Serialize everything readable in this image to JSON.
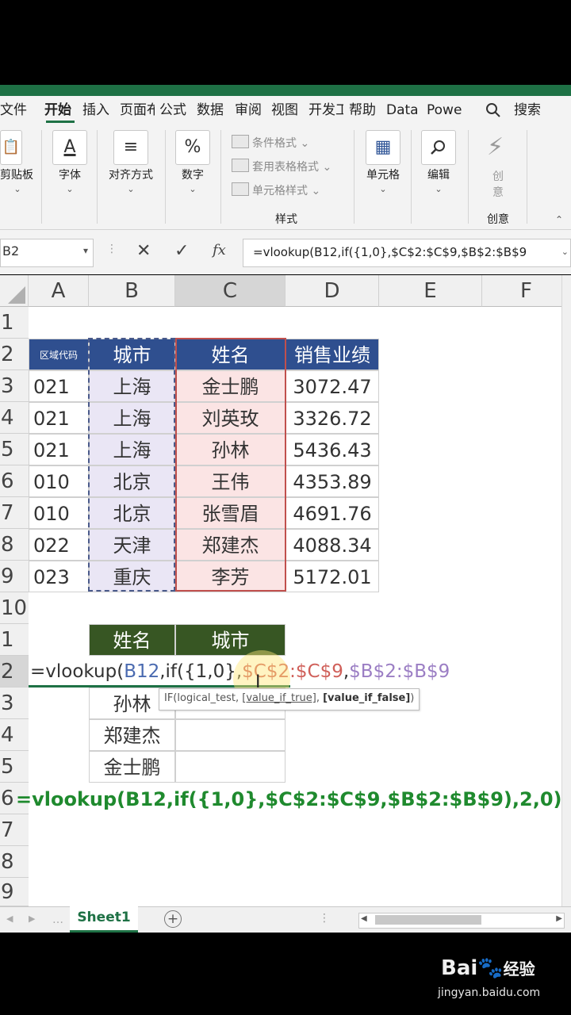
{
  "ribbon_tabs": [
    "文件",
    "开始",
    "插入",
    "页面布",
    "公式",
    "数据",
    "审阅",
    "视图",
    "开发工",
    "帮助",
    "Data",
    "Powe"
  ],
  "search_label": "搜索",
  "ribbon": {
    "clipboard": "剪贴板",
    "font": "字体",
    "font_icon": "A",
    "align": "对齐方式",
    "number": "数字",
    "number_icon": "%",
    "styles_items": [
      "条件格式 ⌄",
      "套用表格格式 ⌄",
      "单元格样式 ⌄"
    ],
    "styles_group": "样式",
    "cells": "单元格",
    "edit": "编辑",
    "creative_line1": "创",
    "creative_line2": "意",
    "creative_group": "创意"
  },
  "formula_bar": {
    "name_box": "B2",
    "cancel": "✕",
    "enter": "✓",
    "fx": "fx",
    "formula": "=vlookup(B12,if({1,0},$C$2:$C$9,$B$2:$B$9"
  },
  "columns": [
    "A",
    "B",
    "C",
    "D",
    "E",
    "F"
  ],
  "rows": [
    "1",
    "2",
    "3",
    "4",
    "5",
    "6",
    "7",
    "8",
    "9",
    "10",
    "1",
    "2",
    "3",
    "4",
    "5",
    "6",
    "7",
    "8",
    "9"
  ],
  "table1": {
    "headers": [
      "区域代码",
      "城市",
      "姓名",
      "销售业绩"
    ],
    "rows": [
      [
        "021",
        "上海",
        "金士鹏",
        "3072.47"
      ],
      [
        "021",
        "上海",
        "刘英玫",
        "3326.72"
      ],
      [
        "021",
        "上海",
        "孙林",
        "5436.43"
      ],
      [
        "010",
        "北京",
        "王伟",
        "4353.89"
      ],
      [
        "010",
        "北京",
        "张雪眉",
        "4691.76"
      ],
      [
        "022",
        "天津",
        "郑建杰",
        "4088.34"
      ],
      [
        "023",
        "重庆",
        "李芳",
        "5172.01"
      ]
    ]
  },
  "table2": {
    "headers": [
      "姓名",
      "城市"
    ],
    "names": [
      "孙林",
      "郑建杰",
      "金士鹏"
    ]
  },
  "edit_formula": {
    "p1": "=vlookup(",
    "p2": "B12",
    "p3": ",if({1,0},",
    "p4": "$C$2:$C$9",
    "p5": ",",
    "p6": "$B$2:$B$9"
  },
  "tooltip": {
    "a": "IF(logical_test, ",
    "b": "[value_if_true]",
    "c": ", ",
    "d": "[value_if_false]",
    "e": ")"
  },
  "overlay_formula": "=vlookup(B12,if({1,0},$C$2:$C$9,$B$2:$B$9),2,0)",
  "sheet_tab": "Sheet1",
  "add_sheet": "+",
  "watermark_main": "Bai",
  "watermark_cn": "经验",
  "watermark_url": "jingyan.baidu.com"
}
